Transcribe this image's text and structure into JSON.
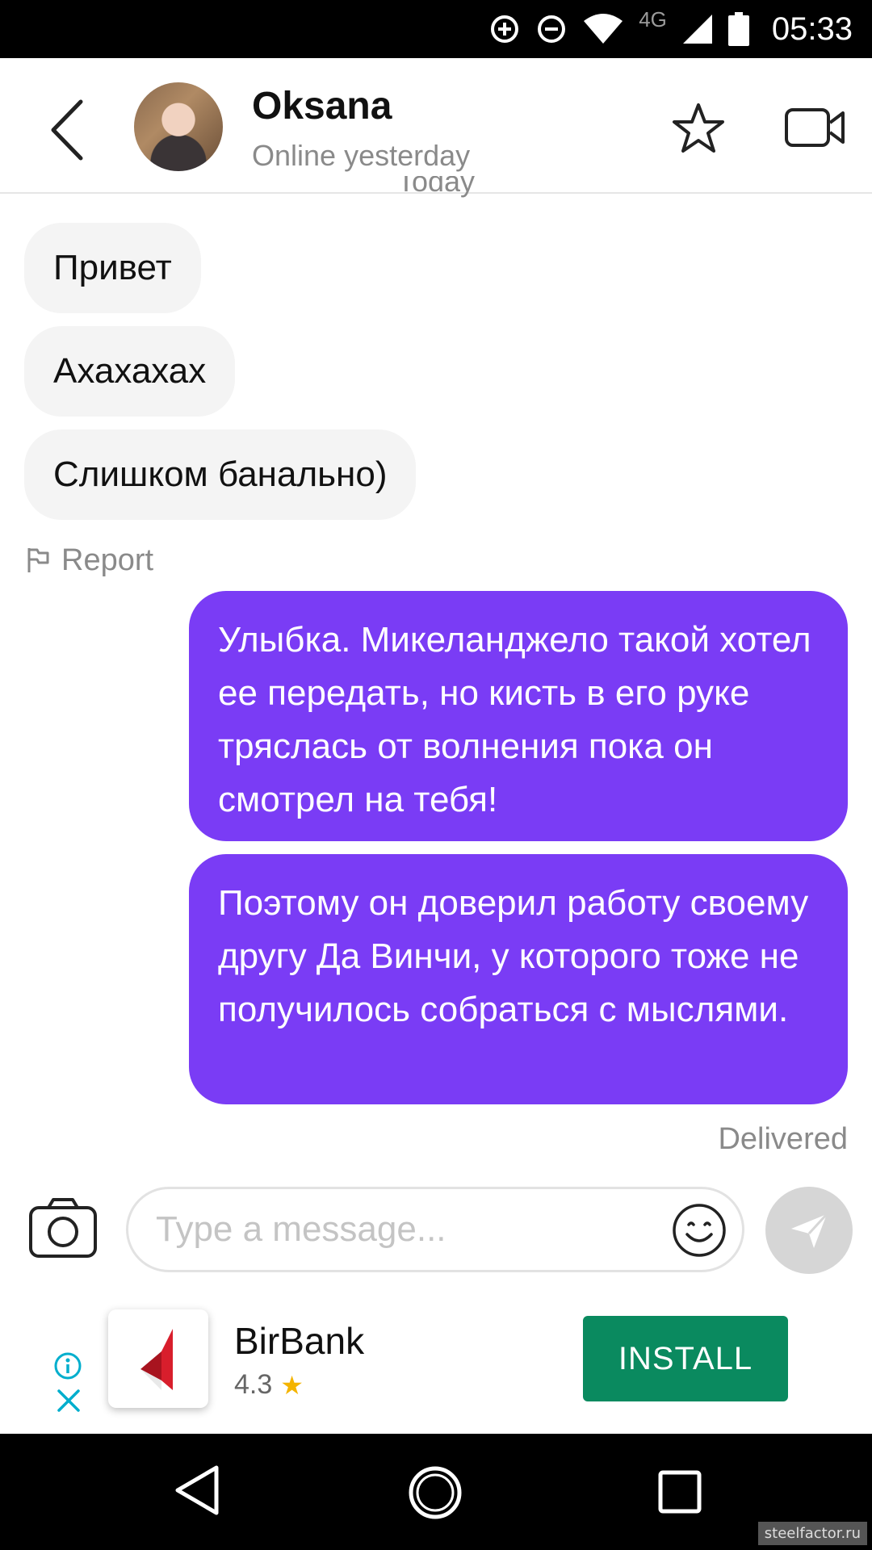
{
  "status_bar": {
    "network": "4G",
    "time": "05:33"
  },
  "header": {
    "contact_name": "Oksana",
    "contact_status": "Online yesterday",
    "icons": [
      "back-arrow-icon",
      "star-icon",
      "video-camera-icon"
    ]
  },
  "chat": {
    "date_separator": "Today",
    "incoming": [
      {
        "text": "Привет"
      },
      {
        "text": "Ахахахах"
      },
      {
        "text": "Слишком банально)"
      }
    ],
    "report_label": "Report",
    "outgoing": [
      {
        "text": "Улыбка. Микеланджело такой хотел ее передать, но  кисть в его руке тряслась от волнения пока он смотрел на тебя!"
      },
      {
        "text": "Поэтому он доверил работу своему другу Да Винчи, у которого тоже не получилось собраться с мыслями."
      }
    ],
    "delivery_status": "Delivered"
  },
  "composer": {
    "placeholder": "Type a message...",
    "value": ""
  },
  "ad": {
    "app_name": "BirBank",
    "rating": "4.3",
    "install_label": "INSTALL"
  },
  "watermark": "steelfactor.ru",
  "colors": {
    "outgoing_bubble": "#7a3cf5",
    "incoming_bubble": "#f4f4f4",
    "install_button": "#0a8a5f",
    "rating_star": "#f4b400"
  }
}
